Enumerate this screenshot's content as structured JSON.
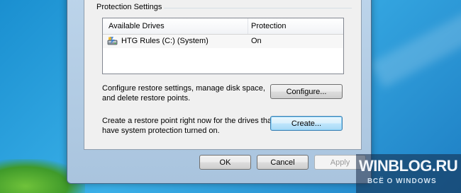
{
  "dialog": {
    "group_title": "Protection Settings",
    "table": {
      "headers": [
        "Available Drives",
        "Protection"
      ],
      "rows": [
        {
          "drive": "HTG Rules (C:) (System)",
          "protection": "On",
          "icon": "hard-drive-icon"
        }
      ]
    },
    "configure": {
      "text_line1": "Configure restore settings, manage disk space,",
      "text_line2": "and delete restore points.",
      "button": "Configure..."
    },
    "create": {
      "text_line1": "Create a restore point right now for the drives that",
      "text_line2": "have system protection turned on.",
      "button": "Create..."
    },
    "footer": {
      "ok": "OK",
      "cancel": "Cancel",
      "apply": "Apply"
    }
  },
  "watermark": {
    "title": "WINBLOG.RU",
    "subtitle": "ВСЁ О WINDOWS"
  },
  "colors": {
    "desktop": "#2a9bd8",
    "dialog_bg": "#f0f0f0",
    "focus_border": "#3c7fb1"
  }
}
